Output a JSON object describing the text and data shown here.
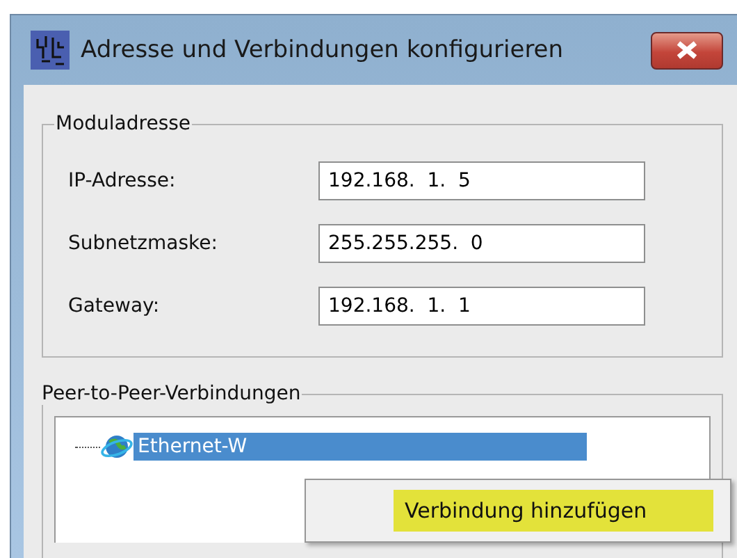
{
  "window": {
    "title": "Adresse und Verbindungen konfigurieren"
  },
  "module_address": {
    "title": "Moduladresse",
    "fields": [
      {
        "label": "IP-Adresse:",
        "value": "192.168.  1.  5"
      },
      {
        "label": "Subnetzmaske:",
        "value": "255.255.255.  0"
      },
      {
        "label": "Gateway:",
        "value": "192.168.  1.  1"
      }
    ]
  },
  "peer_connections": {
    "title": "Peer-to-Peer-Verbindungen",
    "tree": [
      {
        "label": "Ethernet-W",
        "selected": true
      }
    ]
  },
  "context_menu": {
    "items": [
      {
        "label": "Verbindung hinzufügen",
        "selected": true
      }
    ]
  }
}
